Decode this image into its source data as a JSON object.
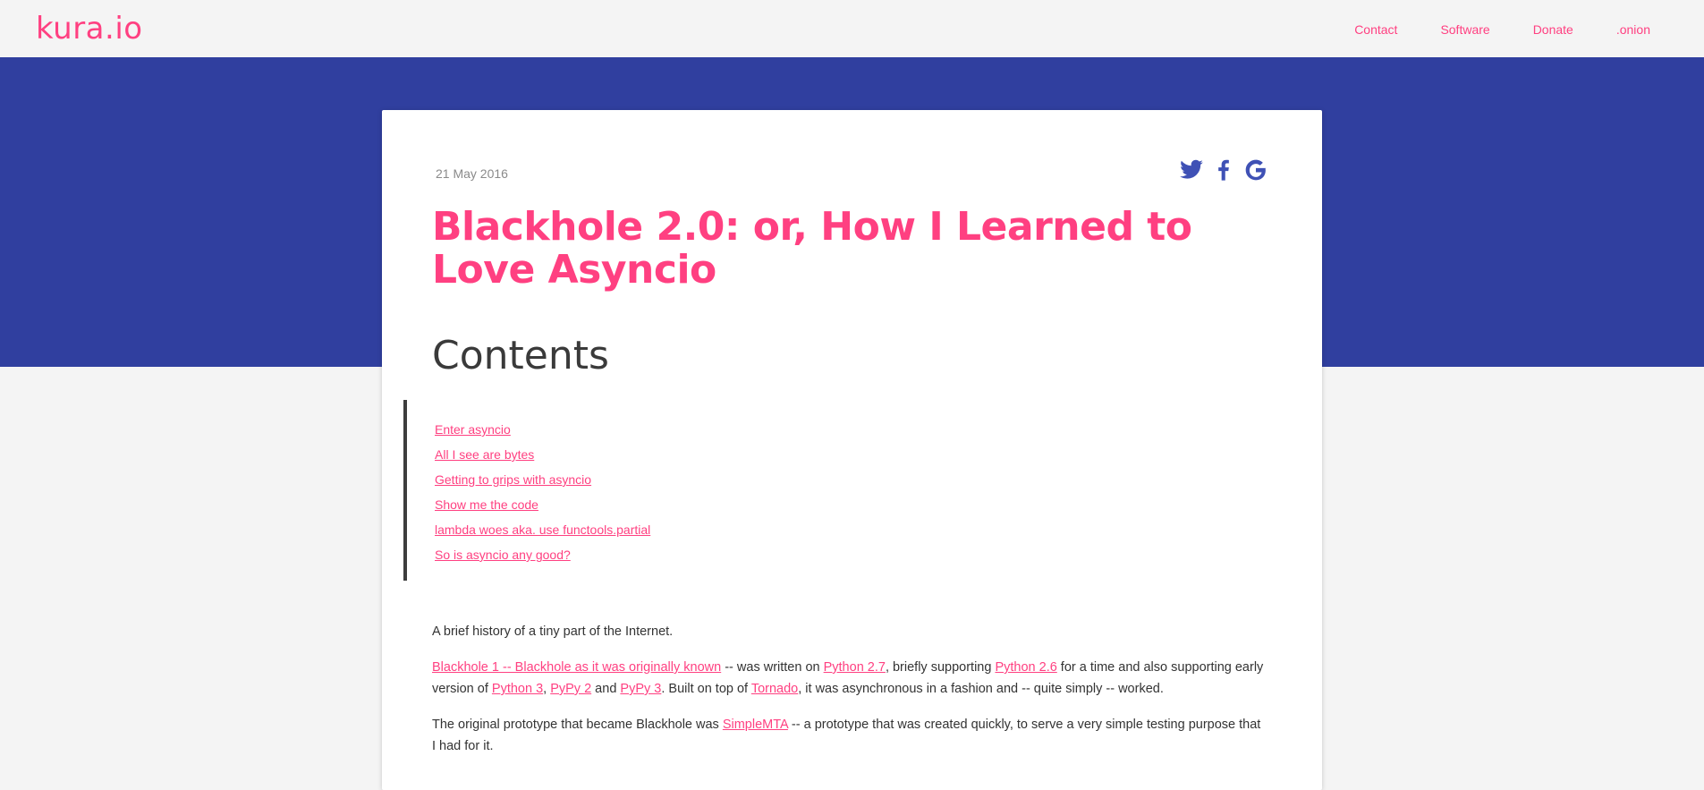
{
  "site": {
    "logo": "kura.io",
    "accent_color": "#ff4081",
    "hero_color": "#303f9f"
  },
  "nav": {
    "items": [
      {
        "label": "Contact"
      },
      {
        "label": "Software"
      },
      {
        "label": "Donate"
      },
      {
        "label": ".onion"
      }
    ]
  },
  "article": {
    "date": "21 May 2016",
    "title": "Blackhole 2.0: or, How I Learned to Love Asyncio",
    "share_icons": [
      "twitter-icon",
      "facebook-icon",
      "google-icon"
    ],
    "contents_heading": "Contents",
    "toc": [
      {
        "label": "Enter asyncio"
      },
      {
        "label": "All I see are bytes"
      },
      {
        "label": "Getting to grips with asyncio"
      },
      {
        "label": "Show me the code"
      },
      {
        "label": "lambda woes aka. use functools.partial"
      },
      {
        "label": "So is asyncio any good?"
      }
    ],
    "p1": "A brief history of a tiny part of the Internet.",
    "p2": {
      "link1": "Blackhole 1 -- Blackhole as it was originally known",
      "t1": " -- was written on ",
      "link2": "Python 2.7",
      "t2": ", briefly supporting ",
      "link3": "Python 2.6",
      "t3": " for a time and also supporting early version of ",
      "link4": "Python 3",
      "t4": ", ",
      "link5": "PyPy 2",
      "t5": " and ",
      "link6": "PyPy 3",
      "t6": ". Built on top of ",
      "link7": "Tornado",
      "t7": ", it was asynchronous in a fashion and -- quite simply -- worked."
    },
    "p3": {
      "t1": "The original prototype that became Blackhole was ",
      "link1": "SimpleMTA",
      "t2": " -- a prototype that was created quickly, to serve a very simple testing purpose that I had for it."
    }
  }
}
